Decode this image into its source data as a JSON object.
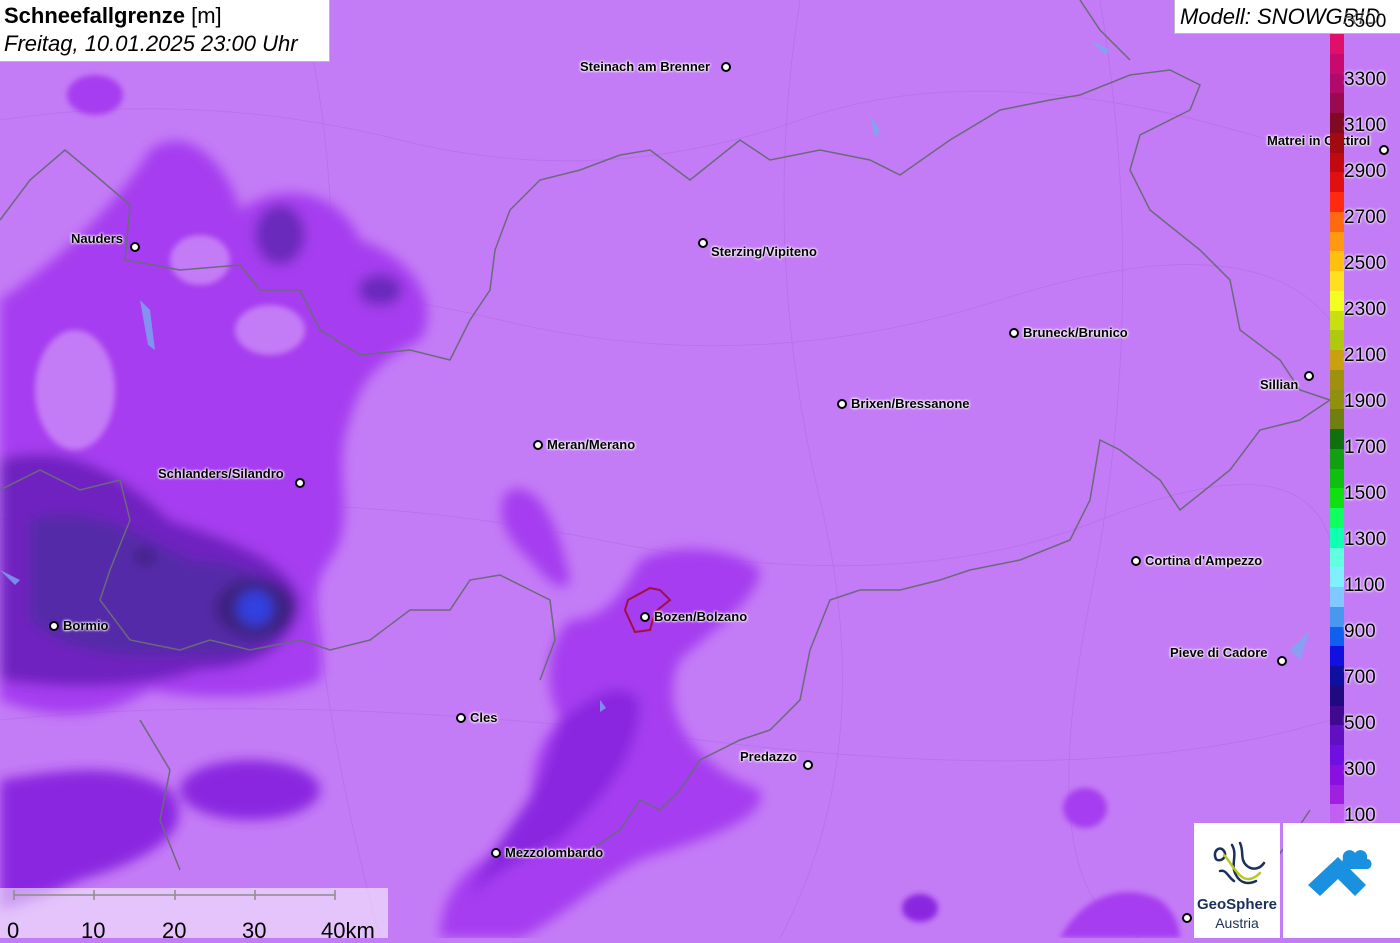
{
  "header": {
    "title_bold": "Schneefallgrenze",
    "title_unit": "[m]",
    "date": "Freitag, 10.01.2025 23:00 Uhr",
    "model": "Modell: SNOWGRID"
  },
  "cities": [
    {
      "name": "Steinach am Brenner"
    },
    {
      "name": "Matrei in Osttirol"
    },
    {
      "name": "Nauders"
    },
    {
      "name": "Sterzing/Vipiteno"
    },
    {
      "name": "Bruneck/Brunico"
    },
    {
      "name": "Sillian"
    },
    {
      "name": "Brixen/Bressanone"
    },
    {
      "name": "Meran/Merano"
    },
    {
      "name": "Schlanders/Silandro"
    },
    {
      "name": "Cortina d'Ampezzo"
    },
    {
      "name": "Bozen/Bolzano"
    },
    {
      "name": "Bormio"
    },
    {
      "name": "Pieve di Cadore"
    },
    {
      "name": "Cles"
    },
    {
      "name": "Predazzo"
    },
    {
      "name": "Mezzolombardo"
    }
  ],
  "legend": {
    "unit": "m",
    "labels": [
      "3500",
      "3300",
      "3100",
      "2900",
      "2700",
      "2500",
      "2300",
      "2100",
      "1900",
      "1700",
      "1500",
      "1300",
      "1100",
      "900",
      "700",
      "500",
      "300",
      "100"
    ],
    "colors": [
      "#e0106a",
      "#c80a6e",
      "#b00a6a",
      "#9a0a50",
      "#800a20",
      "#a00a10",
      "#c00a10",
      "#e01010",
      "#ff2a10",
      "#ff6a10",
      "#ff9a10",
      "#ffc010",
      "#ffe020",
      "#f0ff20",
      "#c8e010",
      "#b0c810",
      "#c8a010",
      "#a09010",
      "#909010",
      "#708010",
      "#107010",
      "#10a010",
      "#10c010",
      "#10e010",
      "#10ff60",
      "#10ffb0",
      "#60ffe0",
      "#80f0ff",
      "#80c8ff",
      "#4898f0",
      "#1060f0",
      "#1010e0",
      "#1010a0",
      "#200a80",
      "#400a90",
      "#6010c0",
      "#7010e0",
      "#8a10e0",
      "#a020e0",
      "#c060f0"
    ]
  },
  "scale": {
    "labels": [
      "0",
      "10",
      "20",
      "30",
      "40km"
    ]
  },
  "logos": {
    "geosphere_line1": "GeoSphere",
    "geosphere_line2": "Austria"
  },
  "colors": {
    "base": "#c47cf6",
    "mid": "#a63cf0",
    "deep": "#7020c0",
    "darkest": "#3c2080",
    "blue": "#3040e0",
    "border": "#6a6a7a",
    "bolzano_outline": "#a01040"
  }
}
